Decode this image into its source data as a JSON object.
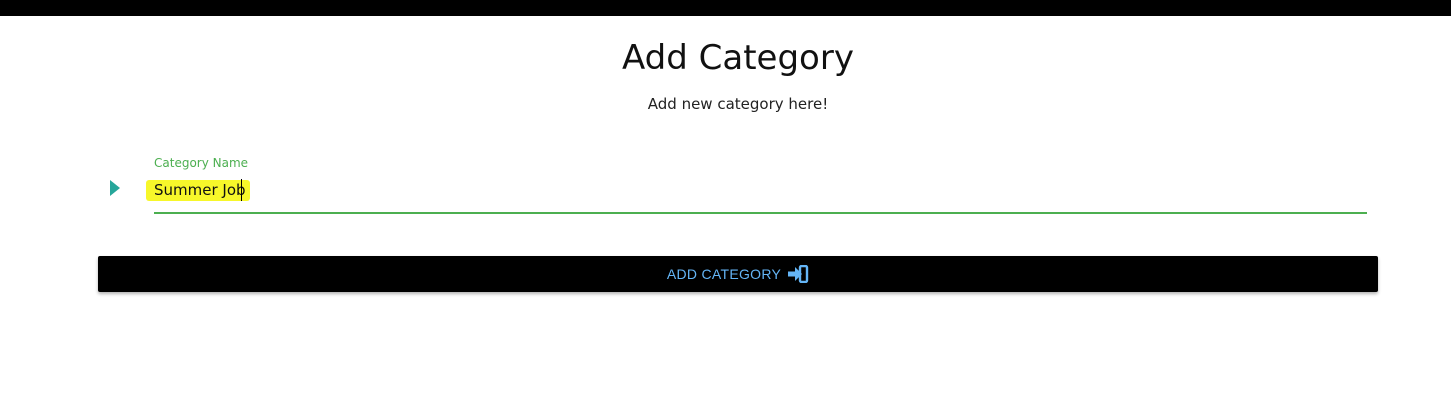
{
  "header": {
    "title": "Add Category",
    "subtitle": "Add new category here!"
  },
  "form": {
    "field": {
      "label": "Category Name",
      "value": "Summer Job",
      "icon": "play-arrow-icon"
    },
    "submit": {
      "label": "ADD CATEGORY",
      "icon": "sign-in-icon"
    }
  },
  "colors": {
    "accent_green": "#4caf50",
    "icon_teal": "#26a69a",
    "button_bg": "#000000",
    "button_text": "#64b5f6",
    "highlight": "#f7f72a"
  }
}
